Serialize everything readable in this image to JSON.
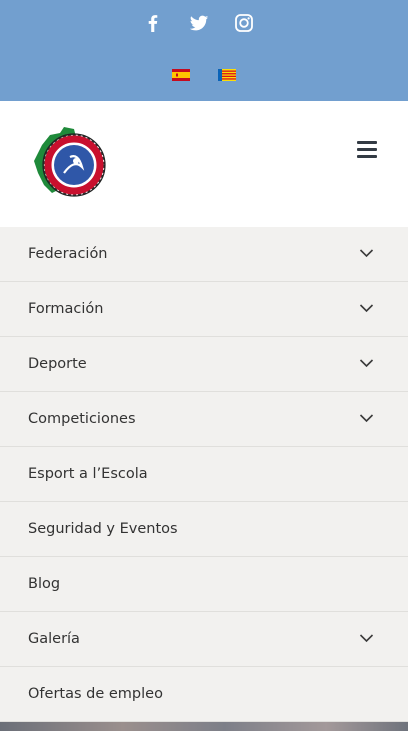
{
  "social": {
    "icons": [
      "facebook-icon",
      "twitter-icon",
      "instagram-icon"
    ],
    "color": "#ffffff"
  },
  "languages": [
    "spain-flag-icon",
    "valencia-flag-icon"
  ],
  "colors": {
    "topbar": "#729fcf",
    "menu_bg": "#f2f1ef",
    "menu_text": "#333333",
    "hamburger": "#333b44"
  },
  "menu": {
    "items": [
      {
        "label": "Federación",
        "has_submenu": true
      },
      {
        "label": "Formación",
        "has_submenu": true
      },
      {
        "label": "Deporte",
        "has_submenu": true
      },
      {
        "label": "Competiciones",
        "has_submenu": true
      },
      {
        "label": "Esport a l’Escola",
        "has_submenu": false
      },
      {
        "label": "Seguridad y Eventos",
        "has_submenu": false
      },
      {
        "label": "Blog",
        "has_submenu": false
      },
      {
        "label": "Galería",
        "has_submenu": true
      },
      {
        "label": "Ofertas de empleo",
        "has_submenu": false
      }
    ]
  }
}
